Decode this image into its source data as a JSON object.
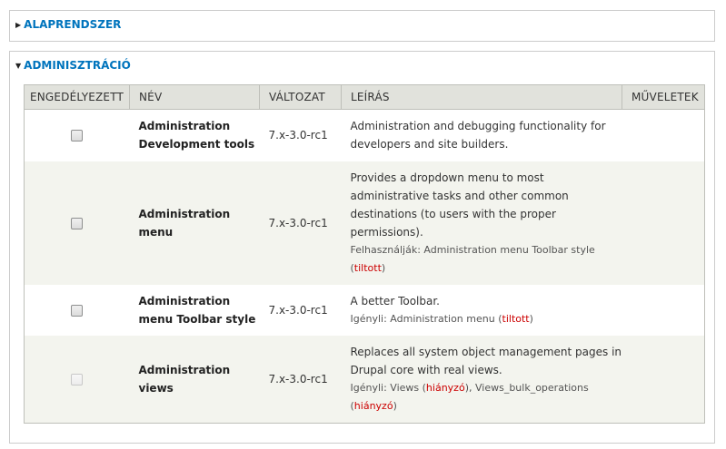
{
  "fieldsets": {
    "core": {
      "title": "ALAPRENDSZER"
    },
    "admin": {
      "title": "ADMINISZTRÁCIÓ"
    }
  },
  "table": {
    "headers": [
      "ENGEDÉLYEZETT",
      "NÉV",
      "VÁLTOZAT",
      "LEÍRÁS",
      "MŰVELETEK"
    ],
    "rows": [
      {
        "name": "Administration Development tools",
        "version": "7.x-3.0-rc1",
        "description": "Administration and debugging functionality for developers and site builders.",
        "enabled": false,
        "checkbox_disabled": false
      },
      {
        "name": "Administration menu",
        "version": "7.x-3.0-rc1",
        "description": "Provides a dropdown menu to most administrative tasks and other common destinations (to users with the proper permissions).",
        "req_label": "Felhasználják: Administration menu Toolbar style",
        "req_status": "tiltott",
        "enabled": false,
        "checkbox_disabled": false
      },
      {
        "name": "Administration menu Toolbar style",
        "version": "7.x-3.0-rc1",
        "description": "A better Toolbar.",
        "req_label": "Igényli: Administration menu",
        "req_status": "tiltott",
        "enabled": false,
        "checkbox_disabled": false
      },
      {
        "name": "Administration views",
        "version": "7.x-3.0-rc1",
        "description": "Replaces all system object management pages in Drupal core with real views.",
        "req_label": "Igényli: Views",
        "req_status": "hiányzó",
        "req_label2": "Views_bulk_operations",
        "req_status2": "hiányzó",
        "enabled": false,
        "checkbox_disabled": true
      }
    ]
  },
  "colors": {
    "link": "#0074bd",
    "header_bg": "#e1e2dc",
    "even_row_bg": "#f3f4ee",
    "warning": "#cc0000"
  }
}
